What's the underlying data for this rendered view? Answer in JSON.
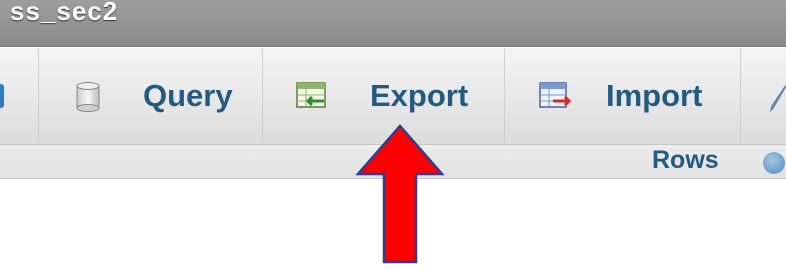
{
  "window": {
    "title": "ss_sec2"
  },
  "tabs": [
    {
      "label": "",
      "icon": "partial-tab-icon"
    },
    {
      "label": "Query",
      "icon": "database-cylinder-icon"
    },
    {
      "label": "Export",
      "icon": "export-table-icon"
    },
    {
      "label": "Import",
      "icon": "import-table-icon"
    },
    {
      "label": "",
      "icon": "pencil-icon"
    }
  ],
  "table_header": {
    "rows_label": "Rows"
  },
  "annotation": {
    "arrow_color": "#ff0000",
    "arrow_outline": "#2e3d8f",
    "points_to": "Export"
  },
  "colors": {
    "tab_text": "#235a81",
    "titlebar": "#8f8f8f"
  }
}
